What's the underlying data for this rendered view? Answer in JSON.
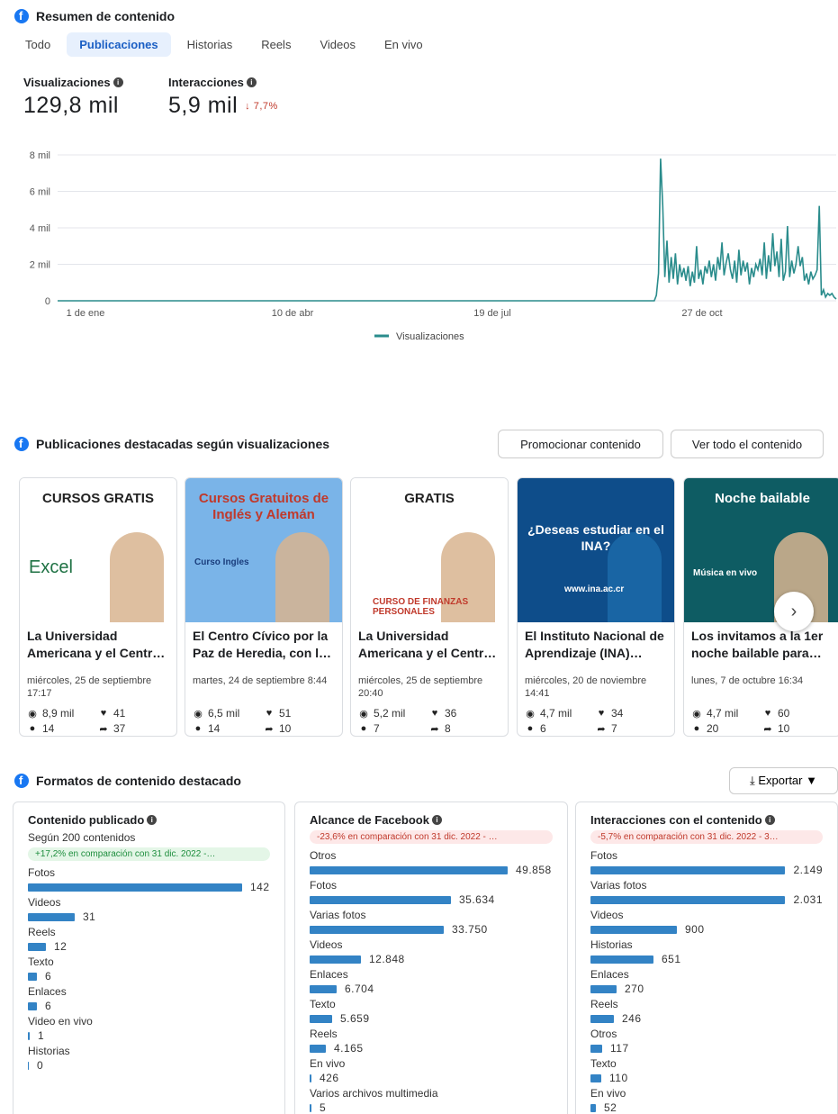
{
  "summary": {
    "title": "Resumen de contenido",
    "tabs": [
      "Todo",
      "Publicaciones",
      "Historias",
      "Reels",
      "Videos",
      "En vivo"
    ],
    "active_tab": "Publicaciones",
    "metrics": {
      "views_label": "Visualizaciones",
      "views_value": "129,8 mil",
      "interactions_label": "Interacciones",
      "interactions_value": "5,9 mil",
      "interactions_change": "↓ 7,7%"
    }
  },
  "chart_data": {
    "type": "line",
    "yticks": [
      "8 mil",
      "6 mil",
      "4 mil",
      "2 mil",
      "0"
    ],
    "xticks": [
      "1 de ene",
      "10 de abr",
      "19 de jul",
      "27 de oct"
    ],
    "ylim": [
      0,
      8000
    ],
    "legend": "Visualizaciones",
    "legend_position": "bottom",
    "color": "#2a8c8c",
    "series": [
      {
        "name": "Visualizaciones",
        "values": [
          0,
          0,
          0,
          0,
          0,
          0,
          0,
          0,
          0,
          0,
          0,
          0,
          0,
          0,
          0,
          0,
          0,
          0,
          0,
          0,
          0,
          0,
          0,
          0,
          0,
          0,
          0,
          0,
          0,
          0,
          0,
          0,
          0,
          0,
          0,
          0,
          0,
          0,
          0,
          0,
          0,
          0,
          0,
          0,
          0,
          0,
          0,
          0,
          0,
          0,
          0,
          0,
          0,
          0,
          0,
          0,
          0,
          0,
          0,
          0,
          0,
          0,
          0,
          0,
          0,
          0,
          0,
          0,
          0,
          0,
          0,
          0,
          0,
          0,
          0,
          0,
          0,
          0,
          0,
          0,
          0,
          0,
          0,
          0,
          0,
          0,
          0,
          0,
          0,
          0,
          0,
          0,
          0,
          0,
          0,
          0,
          0,
          0,
          0,
          0,
          0,
          0,
          0,
          0,
          0,
          0,
          0,
          0,
          0,
          0,
          0,
          0,
          0,
          0,
          0,
          0,
          0,
          0,
          0,
          0,
          0,
          0,
          0,
          0,
          0,
          0,
          0,
          0,
          0,
          0,
          0,
          0,
          0,
          0,
          0,
          0,
          0,
          0,
          0,
          0,
          0,
          0,
          0,
          0,
          0,
          0,
          0,
          0,
          0,
          0,
          0,
          0,
          0,
          0,
          0,
          0,
          0,
          0,
          0,
          0,
          0,
          0,
          0,
          0,
          0,
          0,
          0,
          0,
          0,
          0,
          0,
          0,
          0,
          0,
          0,
          0,
          0,
          0,
          0,
          0,
          0,
          0,
          0,
          0,
          0,
          0,
          0,
          0,
          0,
          0,
          0,
          0,
          0,
          0,
          0,
          0,
          0,
          0,
          0,
          0,
          0,
          0,
          0,
          0,
          0,
          0,
          0,
          0,
          0,
          0,
          0,
          0,
          0,
          0,
          0,
          0,
          0,
          0,
          0,
          0,
          0,
          0,
          0,
          0,
          0,
          0,
          0,
          0,
          0,
          0,
          0,
          0,
          0,
          0,
          0,
          0,
          0,
          0,
          0,
          0,
          0,
          0,
          0,
          0,
          0,
          0,
          0,
          0,
          0,
          0,
          0,
          0,
          0,
          0,
          0,
          0,
          0,
          0,
          0,
          0,
          0,
          0,
          0,
          0,
          0,
          0,
          0,
          0,
          0,
          0,
          0,
          0,
          0,
          0,
          0,
          0,
          0,
          0,
          0,
          0,
          0,
          0,
          0,
          300,
          1500,
          7800,
          5200,
          1300,
          3300,
          1000,
          2400,
          1200,
          2600,
          900,
          2000,
          1300,
          1800,
          1100,
          1900,
          800,
          1600,
          1000,
          3000,
          1200,
          1700,
          900,
          1900,
          1500,
          2200,
          1300,
          2000,
          1100,
          2400,
          1700,
          3200,
          1400,
          2100,
          2600,
          1700,
          1200,
          2200,
          1000,
          2800,
          1400,
          2200,
          1600,
          2100,
          900,
          1800,
          1300,
          2000,
          1700,
          2300,
          1400,
          3200,
          1200,
          2500,
          1600,
          3700,
          1900,
          2700,
          1300,
          3400,
          1100,
          1600,
          4100,
          1300,
          2200,
          1500,
          2000,
          3000,
          1900,
          2400,
          1100,
          1500,
          900,
          1600,
          1200,
          1400,
          1700,
          5200,
          300,
          600,
          200,
          400,
          300,
          400,
          200,
          100
        ]
      }
    ]
  },
  "featured": {
    "title": "Publicaciones destacadas según visualizaciones",
    "promote_label": "Promocionar contenido",
    "view_all_label": "Ver todo el contenido",
    "cards": [
      {
        "title": "La Universidad Americana y el Centr…",
        "date": "miércoles, 25 de septiembre 17:17",
        "views": "8,9 mil",
        "likes": "41",
        "comments": "14",
        "shares": "37",
        "thumb_heading": "CURSOS GRATIS",
        "thumb_word": "Excel"
      },
      {
        "title": "El Centro Cívico por la Paz de Heredia, con l…",
        "date": "martes, 24 de septiembre 8:44",
        "views": "6,5 mil",
        "likes": "51",
        "comments": "14",
        "shares": "10",
        "thumb_heading": "Cursos Gratuitos de Inglés y Alemán",
        "thumb_word": "Curso Ingles"
      },
      {
        "title": "La Universidad Americana y el Centr…",
        "date": "miércoles, 25 de septiembre 20:40",
        "views": "5,2 mil",
        "likes": "36",
        "comments": "7",
        "shares": "8",
        "thumb_heading": "GRATIS",
        "thumb_word": "CURSO DE FINANZAS PERSONALES"
      },
      {
        "title": "El Instituto Nacional de Aprendizaje (INA)…",
        "date": "miércoles, 20 de noviembre 14:41",
        "views": "4,7 mil",
        "likes": "34",
        "comments": "6",
        "shares": "7",
        "thumb_heading": "¿Deseas estudiar en el INA?",
        "thumb_word": "www.ina.ac.cr"
      },
      {
        "title": "Los invitamos a la 1er noche bailable para…",
        "date": "lunes, 7 de octubre 16:34",
        "views": "4,7 mil",
        "likes": "60",
        "comments": "20",
        "shares": "10",
        "thumb_heading": "Noche bailable",
        "thumb_word": "Música en vivo"
      }
    ]
  },
  "formats": {
    "title": "Formatos de contenido destacado",
    "export_label": "Exportar",
    "bar_color": "#3383c5",
    "panels": [
      {
        "title": "Contenido publicado",
        "subtitle": "Según 200 contenidos",
        "change": "+17,2% en comparación con 31 dic. 2022 -…",
        "change_type": "pos",
        "max": 142,
        "rows": [
          {
            "label": "Fotos",
            "value": 142,
            "display": "142"
          },
          {
            "label": "Videos",
            "value": 31,
            "display": "31"
          },
          {
            "label": "Reels",
            "value": 12,
            "display": "12"
          },
          {
            "label": "Texto",
            "value": 6,
            "display": "6"
          },
          {
            "label": "Enlaces",
            "value": 6,
            "display": "6"
          },
          {
            "label": "Video en vivo",
            "value": 1,
            "display": "1"
          },
          {
            "label": "Historias",
            "value": 0,
            "display": "0"
          }
        ]
      },
      {
        "title": "Alcance de Facebook",
        "subtitle": "",
        "change": "-23,6% en comparación con 31 dic. 2022 - …",
        "change_type": "neg",
        "max": 49858,
        "rows": [
          {
            "label": "Otros",
            "value": 49858,
            "display": "49.858"
          },
          {
            "label": "Fotos",
            "value": 35634,
            "display": "35.634"
          },
          {
            "label": "Varias fotos",
            "value": 33750,
            "display": "33.750"
          },
          {
            "label": "Videos",
            "value": 12848,
            "display": "12.848"
          },
          {
            "label": "Enlaces",
            "value": 6704,
            "display": "6.704"
          },
          {
            "label": "Texto",
            "value": 5659,
            "display": "5.659"
          },
          {
            "label": "Reels",
            "value": 4165,
            "display": "4.165"
          },
          {
            "label": "En vivo",
            "value": 426,
            "display": "426"
          },
          {
            "label": "Varios archivos multimedia",
            "value": 5,
            "display": "5"
          }
        ]
      },
      {
        "title": "Interacciones con el contenido",
        "subtitle": "",
        "change": "-5,7% en comparación con 31 dic. 2022 - 3…",
        "change_type": "neg",
        "max": 2149,
        "rows": [
          {
            "label": "Fotos",
            "value": 2149,
            "display": "2.149"
          },
          {
            "label": "Varias fotos",
            "value": 2031,
            "display": "2.031"
          },
          {
            "label": "Videos",
            "value": 900,
            "display": "900"
          },
          {
            "label": "Historias",
            "value": 651,
            "display": "651"
          },
          {
            "label": "Enlaces",
            "value": 270,
            "display": "270"
          },
          {
            "label": "Reels",
            "value": 246,
            "display": "246"
          },
          {
            "label": "Otros",
            "value": 117,
            "display": "117"
          },
          {
            "label": "Texto",
            "value": 110,
            "display": "110"
          },
          {
            "label": "En vivo",
            "value": 52,
            "display": "52"
          }
        ]
      }
    ]
  }
}
